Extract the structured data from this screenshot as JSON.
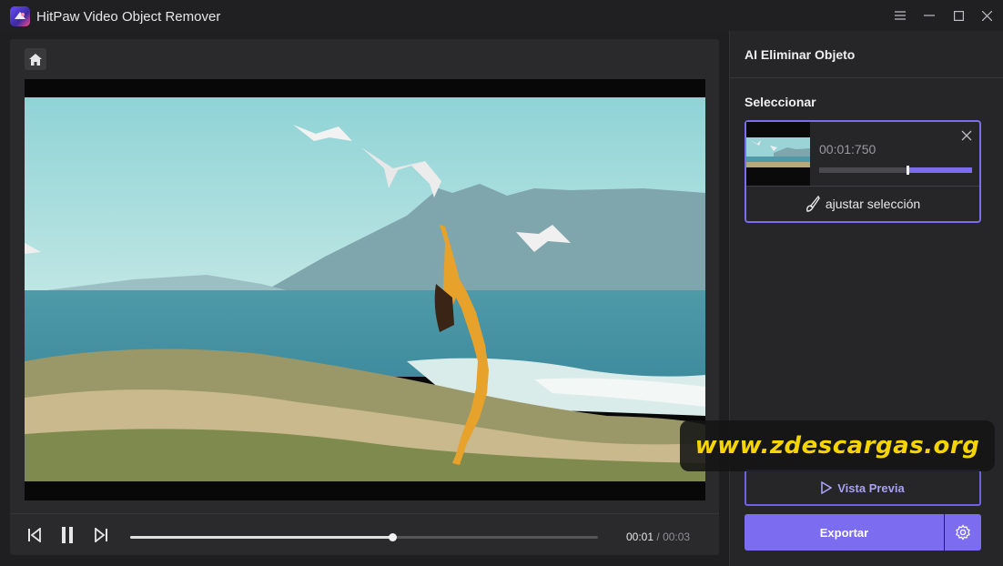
{
  "app": {
    "title": "HitPaw Video Object Remover",
    "logo_icon": "hitpaw-logo-icon",
    "window_controls": [
      "menu-icon",
      "minimize-icon",
      "maximize-icon",
      "close-icon"
    ]
  },
  "editor": {
    "home_icon": "home-icon",
    "player": {
      "controls": [
        "previous-frame-icon",
        "pause-icon",
        "next-frame-icon"
      ],
      "progress": 0.56,
      "current_time": "00:01",
      "separator": "/",
      "total_time": "00:03"
    }
  },
  "sidebar": {
    "title": "AI Eliminar Objeto",
    "section_label": "Seleccionar",
    "selection": {
      "time": "00:01:750",
      "range_start": 0.58,
      "range_end": 1.0,
      "adjust_label": "ajustar selección",
      "adjust_icon": "brush-icon"
    },
    "preview_label": "Vista Previa",
    "export_label": "Exportar"
  },
  "watermark": {
    "text": "www.zdescargas.org"
  },
  "colors": {
    "accent": "#7b6cf0",
    "background": "#1f1f21",
    "panel": "#2a2a2c",
    "watermark_text": "#f5d400"
  }
}
